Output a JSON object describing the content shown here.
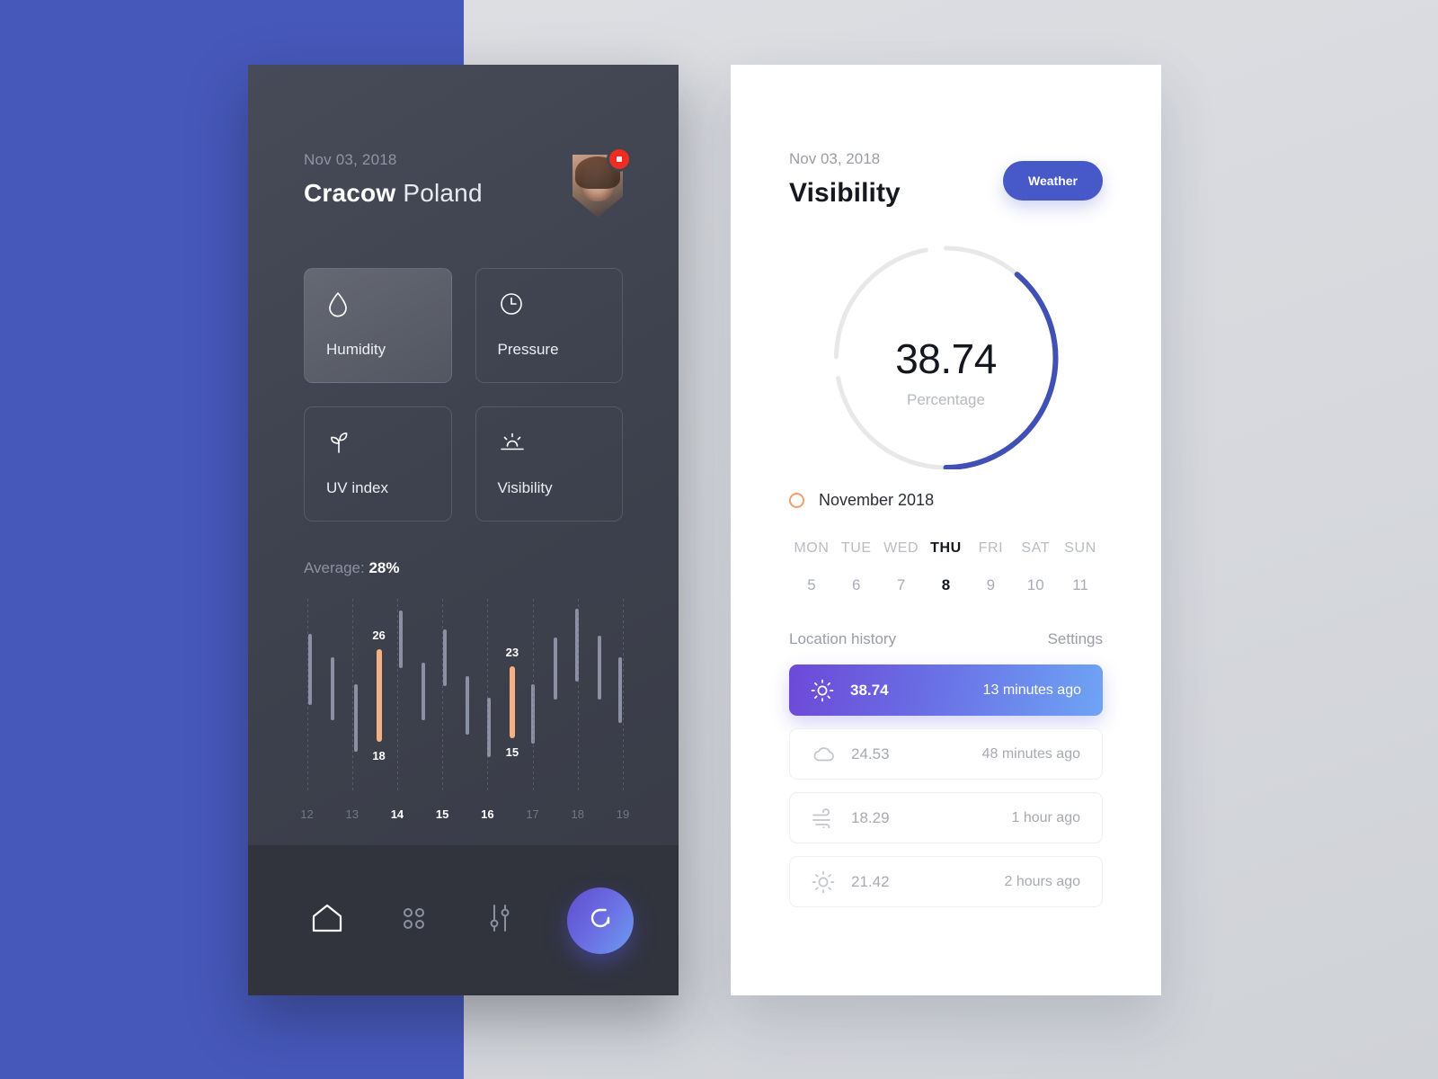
{
  "theme": {
    "accent_blue": "#4758c8",
    "bg_blue_block": "#4758bb",
    "bg_grey": "#dcdee2",
    "dark_panel": "#3e424e",
    "dark_nav": "#31333d",
    "highlight_orange": "#f5b183",
    "badge_red": "#f02d22"
  },
  "dark_phone": {
    "date": "Nov 03, 2018",
    "city_bold": "Cracow",
    "city_light": "Poland",
    "avatar": "user-avatar",
    "avatar_badge": "notification-badge",
    "tiles": [
      {
        "label": "Humidity",
        "icon": "droplet-icon",
        "active": true
      },
      {
        "label": "Pressure",
        "icon": "clock-icon",
        "active": false
      },
      {
        "label": "UV index",
        "icon": "sprout-icon",
        "active": false
      },
      {
        "label": "Visibility",
        "icon": "sunrise-icon",
        "active": false
      }
    ],
    "average_label": "Average:",
    "average_value": "28%",
    "nav": [
      {
        "name": "home",
        "icon": "home-icon",
        "active": true
      },
      {
        "name": "apps",
        "icon": "grid-dots-icon",
        "active": false
      },
      {
        "name": "settings",
        "icon": "sliders-icon",
        "active": false
      }
    ],
    "fab": {
      "icon": "refresh-icon",
      "label": ""
    }
  },
  "chart_data": {
    "type": "bar",
    "title": "Average: 28%",
    "xlabel": "",
    "ylabel": "",
    "grid": true,
    "legend": false,
    "categories": [
      "12",
      "13",
      "14",
      "15",
      "16",
      "17",
      "18",
      "19"
    ],
    "highlighted_categories": [
      "14",
      "15",
      "16"
    ],
    "annotations": [
      {
        "bar_index": 3,
        "top_label": "26",
        "bottom_label": "18"
      },
      {
        "bar_index": 9,
        "top_label": "23",
        "bottom_label": "15"
      }
    ],
    "note": "floating range bars: each bar spans from low to high value (percent scale 0-100 mapped to plot height)",
    "bars": [
      {
        "x_pct": 2.0,
        "high": 82,
        "low": 45,
        "highlight": false
      },
      {
        "x_pct": 13.0,
        "high": 70,
        "low": 37,
        "highlight": false
      },
      {
        "x_pct": 24.0,
        "high": 56,
        "low": 21,
        "highlight": false
      },
      {
        "x_pct": 34.5,
        "high": 74,
        "low": 26,
        "highlight": true,
        "high_label": "26",
        "low_label": "18"
      },
      {
        "x_pct": 45.5,
        "high": 94,
        "low": 64,
        "highlight": false
      },
      {
        "x_pct": 56.0,
        "high": 67,
        "low": 37,
        "highlight": false
      },
      {
        "x_pct": 66.5,
        "high": 84,
        "low": 55,
        "highlight": false
      },
      {
        "x_pct": 77.0,
        "high": 60,
        "low": 30,
        "highlight": false
      },
      {
        "x_pct": 87.5,
        "high": 49,
        "low": 18,
        "highlight": false
      },
      {
        "x_pct": 98.0,
        "high": 65,
        "low": 28,
        "highlight": true,
        "high_label": "23",
        "low_label": "15"
      },
      {
        "x_pct": 108.5,
        "high": 56,
        "low": 25,
        "highlight": false
      },
      {
        "x_pct": 119.0,
        "high": 80,
        "low": 48,
        "highlight": false
      },
      {
        "x_pct": 129.5,
        "high": 95,
        "low": 57,
        "highlight": false
      },
      {
        "x_pct": 140.0,
        "high": 81,
        "low": 48,
        "highlight": false
      },
      {
        "x_pct": 150.0,
        "high": 70,
        "low": 36,
        "highlight": false
      }
    ]
  },
  "light_phone": {
    "date": "Nov 03, 2018",
    "title": "Visibility",
    "pill_label": "Weather",
    "gauge": {
      "value": "38.74",
      "unit_label": "Percentage",
      "progress_percent": 38.74,
      "track_color": "#e8e8e8",
      "progress_color": "#4050b5"
    },
    "month_label": "November 2018",
    "calendar": {
      "days": [
        "MON",
        "TUE",
        "WED",
        "THU",
        "FRI",
        "SAT",
        "SUN"
      ],
      "numbers": [
        "5",
        "6",
        "7",
        "8",
        "9",
        "10",
        "11"
      ],
      "selected_index": 3
    },
    "location_history": {
      "title": "Location history",
      "settings_label": "Settings",
      "rows": [
        {
          "icon": "sun-icon",
          "value": "38.74",
          "ago": "13 minutes ago",
          "active": true
        },
        {
          "icon": "cloud-icon",
          "value": "24.53",
          "ago": "48 minutes ago",
          "active": false
        },
        {
          "icon": "wind-icon",
          "value": "18.29",
          "ago": "1 hour ago",
          "active": false
        },
        {
          "icon": "sun-icon",
          "value": "21.42",
          "ago": "2 hours ago",
          "active": false
        }
      ]
    }
  }
}
